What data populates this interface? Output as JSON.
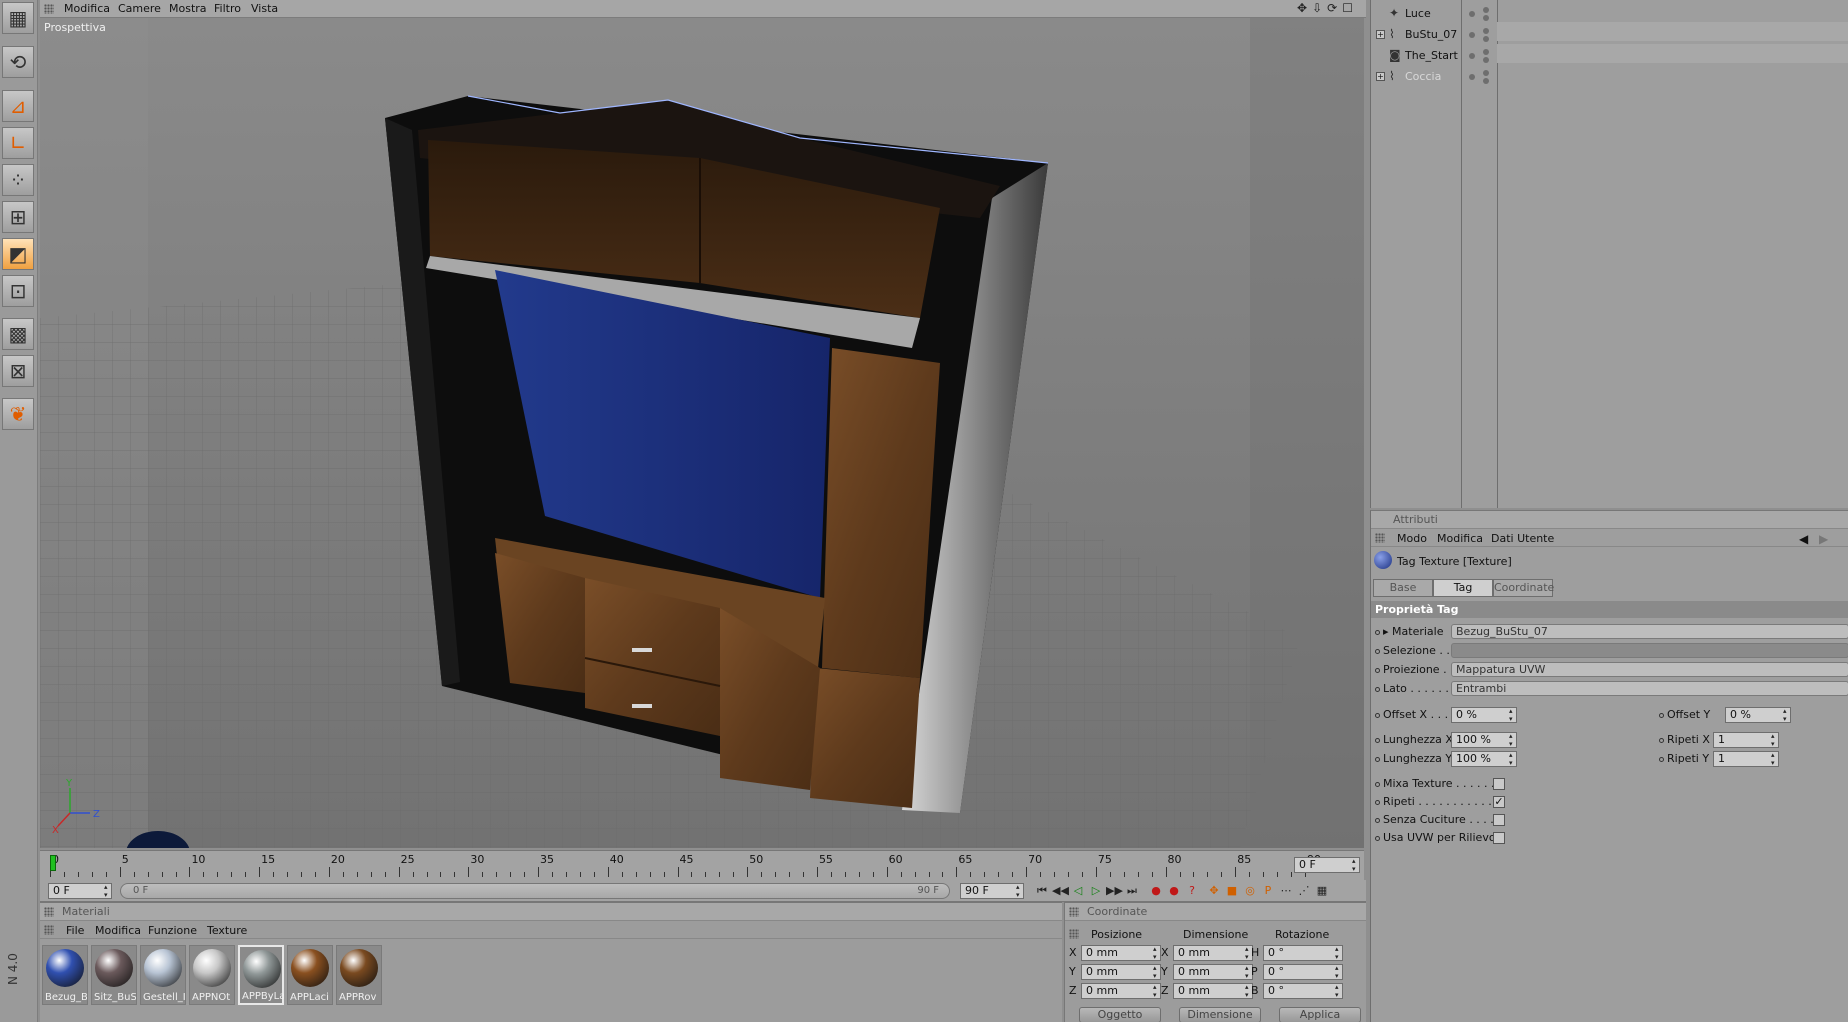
{
  "viewport": {
    "menu": [
      "Modifica",
      "Camere",
      "Mostra",
      "Filtro",
      "Vista"
    ],
    "title": "Prospettiva",
    "nav_icons": [
      "move-icon",
      "dolly-icon",
      "rotate-icon",
      "maximize-icon"
    ]
  },
  "toolbar": {
    "buttons": [
      {
        "icon": "layout-icon",
        "active": false
      },
      {
        "icon": "undo-icon",
        "active": false
      },
      {
        "icon": "object-axis-icon",
        "active": false
      },
      {
        "icon": "model-axis-icon",
        "active": false
      },
      {
        "icon": "points-icon",
        "active": false
      },
      {
        "icon": "edges-icon",
        "active": false
      },
      {
        "icon": "polygons-icon",
        "active": true
      },
      {
        "icon": "uvw-icon",
        "active": false
      },
      {
        "icon": "texture-icon",
        "active": false
      },
      {
        "icon": "texture-axis-icon",
        "active": false
      },
      {
        "icon": "paint-icon",
        "active": false
      }
    ],
    "vertical_label": "N 4.0"
  },
  "timeline": {
    "labels": [
      "0",
      "5",
      "10",
      "15",
      "20",
      "25",
      "30",
      "35",
      "40",
      "45",
      "50",
      "55",
      "60",
      "65",
      "70",
      "75",
      "80",
      "85",
      "90"
    ],
    "current_frame": "0 F",
    "start_field": "0 F",
    "range_start": "0 F",
    "range_end": "90 F",
    "end_field": "90 F"
  },
  "transport": {
    "buttons": [
      "⏮",
      "◀◀",
      "◁",
      "▷",
      "▶▶",
      "⏭"
    ],
    "record_buttons": [
      "●",
      "●",
      "?"
    ],
    "key_buttons": [
      "✥",
      "■",
      "◎",
      "P",
      "⋯",
      "⋰",
      "▦"
    ]
  },
  "materials": {
    "title": "Materiali",
    "menu": [
      "File",
      "Modifica",
      "Funzione",
      "Texture"
    ],
    "items": [
      {
        "label": "Bezug_B",
        "color": "#3050b0",
        "selected": false
      },
      {
        "label": "Sitz_BuS",
        "color": "#6b5a5c",
        "selected": false
      },
      {
        "label": "Gestell_I",
        "color": "#b8c4d4",
        "selected": false
      },
      {
        "label": "APPNOt",
        "color": "#c8c8c8",
        "selected": false
      },
      {
        "label": "APPByLa",
        "color": "#909898",
        "selected": true
      },
      {
        "label": "APPLaci",
        "color": "#8a5020",
        "selected": false
      },
      {
        "label": "APPRov",
        "color": "#7a4a20",
        "selected": false
      }
    ]
  },
  "coords": {
    "title": "Coordinate",
    "headers": [
      "Posizione",
      "Dimensione",
      "Rotazione"
    ],
    "rows": [
      {
        "a1": "X",
        "v1": "0 mm",
        "a2": "X",
        "v2": "0 mm",
        "a3": "H",
        "v3": "0 °"
      },
      {
        "a1": "Y",
        "v1": "0 mm",
        "a2": "Y",
        "v2": "0 mm",
        "a3": "P",
        "v3": "0 °"
      },
      {
        "a1": "Z",
        "v1": "0 mm",
        "a2": "Z",
        "v2": "0 mm",
        "a3": "B",
        "v3": "0 °"
      }
    ],
    "mode_select": "Oggetto",
    "dim_select": "Dimensione",
    "apply": "Applica"
  },
  "objects": [
    {
      "name": "Luce",
      "icon": "light-icon",
      "expandable": false,
      "dim": false
    },
    {
      "name": "BuStu_07",
      "icon": "null-icon",
      "expandable": true,
      "dim": false
    },
    {
      "name": "The_Start",
      "icon": "camera-icon",
      "expandable": false,
      "dim": false
    },
    {
      "name": "Coccia",
      "icon": "null-icon",
      "expandable": true,
      "dim": true
    }
  ],
  "attributes": {
    "title": "Attributi",
    "menu": [
      "Modo",
      "Modifica",
      "Dati Utente"
    ],
    "object_title": "Tag Texture [Texture]",
    "tabs": [
      "Base",
      "Tag",
      "Coordinate"
    ],
    "active_tab": "Tag",
    "section": "Proprietà Tag",
    "materiale_label": "Materiale",
    "materiale_value": "Bezug_BuStu_07",
    "selezione_label": "Selezione . . .",
    "selezione_value": "",
    "proiezione_label": "Proiezione . .",
    "proiezione_value": "Mappatura UVW",
    "lato_label": "Lato . . . . . . .",
    "lato_value": "Entrambi",
    "offset_x_label": "Offset X . . . .",
    "offset_x_value": "0 %",
    "offset_y_label": "Offset Y",
    "offset_y_value": "0 %",
    "lunghezza_x_label": "Lunghezza X",
    "lunghezza_x_value": "100 %",
    "ripeti_x_label": "Ripeti X",
    "ripeti_x_value": "1",
    "lunghezza_y_label": "Lunghezza Y",
    "lunghezza_y_value": "100 %",
    "ripeti_y_label": "Ripeti Y",
    "ripeti_y_value": "1",
    "checks": [
      {
        "label": "Mixa Texture . . . . . .",
        "checked": false
      },
      {
        "label": "Ripeti . . . . . . . . . . . .",
        "checked": true
      },
      {
        "label": "Senza Cuciture . . . . .",
        "checked": false
      },
      {
        "label": "Usa UVW per Rilievo",
        "checked": false
      }
    ]
  },
  "colors": {
    "wood": "#6b4423",
    "panel_blue": "#1f2f78",
    "frame": "#0e0e0e",
    "accent": "#e07a10"
  }
}
